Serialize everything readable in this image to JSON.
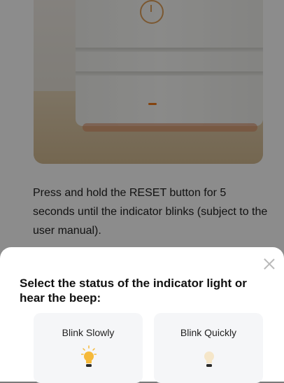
{
  "instruction": {
    "text": "Press and hold the RESET button for 5 seconds until the indicator blinks (subject to the user manual)."
  },
  "sheet": {
    "title": "Select the status of the indicator light or hear the beep:",
    "options": [
      {
        "label": "Blink Slowly",
        "icon": "bulb-on-icon"
      },
      {
        "label": "Blink Quickly",
        "icon": "bulb-dim-icon"
      }
    ]
  },
  "colors": {
    "bulb_on": "#f5b93a",
    "bulb_dim": "#f5e6c9",
    "indicator_led": "#f07a1a",
    "overlay": "rgba(0,0,0,0.45)"
  }
}
